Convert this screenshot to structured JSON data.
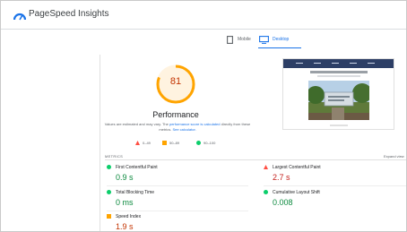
{
  "app": {
    "title": "PageSpeed Insights"
  },
  "tabs": [
    {
      "label": "Mobile",
      "selected": false
    },
    {
      "label": "Desktop",
      "selected": true
    }
  ],
  "score": {
    "value": "81",
    "title": "Performance",
    "note_text": "Values are estimated and may vary. The ",
    "note_link1": "performance score is calculated",
    "note_text2": " directly from these metrics. ",
    "note_link2": "See calculator."
  },
  "legend": [
    {
      "range": "0–49"
    },
    {
      "range": "50–89"
    },
    {
      "range": "90–100"
    }
  ],
  "metrics_section": {
    "label": "METRICS",
    "expand": "Expand view"
  },
  "metrics": [
    {
      "name": "First Contentful Paint",
      "value": "0.9 s",
      "status": "good"
    },
    {
      "name": "Largest Contentful Paint",
      "value": "2.7 s",
      "status": "poor"
    },
    {
      "name": "Total Blocking Time",
      "value": "0 ms",
      "status": "good"
    },
    {
      "name": "Cumulative Layout Shift",
      "value": "0.008",
      "status": "good"
    },
    {
      "name": "Speed Index",
      "value": "1.9 s",
      "status": "average"
    }
  ],
  "colors": {
    "accent": "#1a73e8",
    "good": "#0cce6b",
    "average": "#ffa400",
    "poor": "#ff4e42"
  },
  "icons": [
    "pagespeed-logo-icon",
    "mobile-icon",
    "desktop-icon",
    "triangle-icon",
    "square-icon",
    "circle-icon"
  ]
}
